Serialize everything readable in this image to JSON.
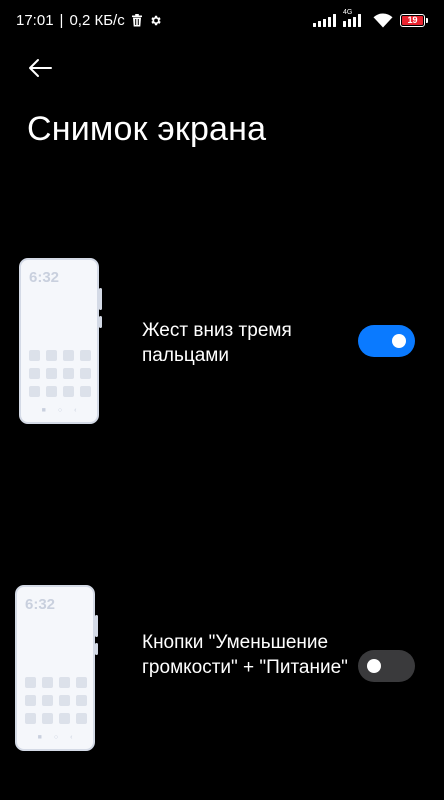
{
  "status_bar": {
    "time": "17:01",
    "separator": "|",
    "speed": "0,2 КБ/с",
    "network_type": "4G",
    "battery": "19",
    "battery_color": "#e8232f"
  },
  "header": {
    "title": "Снимок экрана"
  },
  "options": [
    {
      "label": "Жест вниз тремя пальцами",
      "preview_time": "6:32",
      "enabled": true,
      "toggle_color": "#0a7aff"
    },
    {
      "label": "Кнопки \"Уменьшение громкости\" + \"Питание\"",
      "preview_time": "6:32",
      "enabled": false,
      "toggle_color": "#3a3a3c"
    }
  ],
  "icons": {
    "back": "arrow-left-icon",
    "delete": "trash-icon",
    "settings": "gear-icon",
    "signal": "signal-icon",
    "wifi": "wifi-icon",
    "battery": "battery-icon"
  }
}
